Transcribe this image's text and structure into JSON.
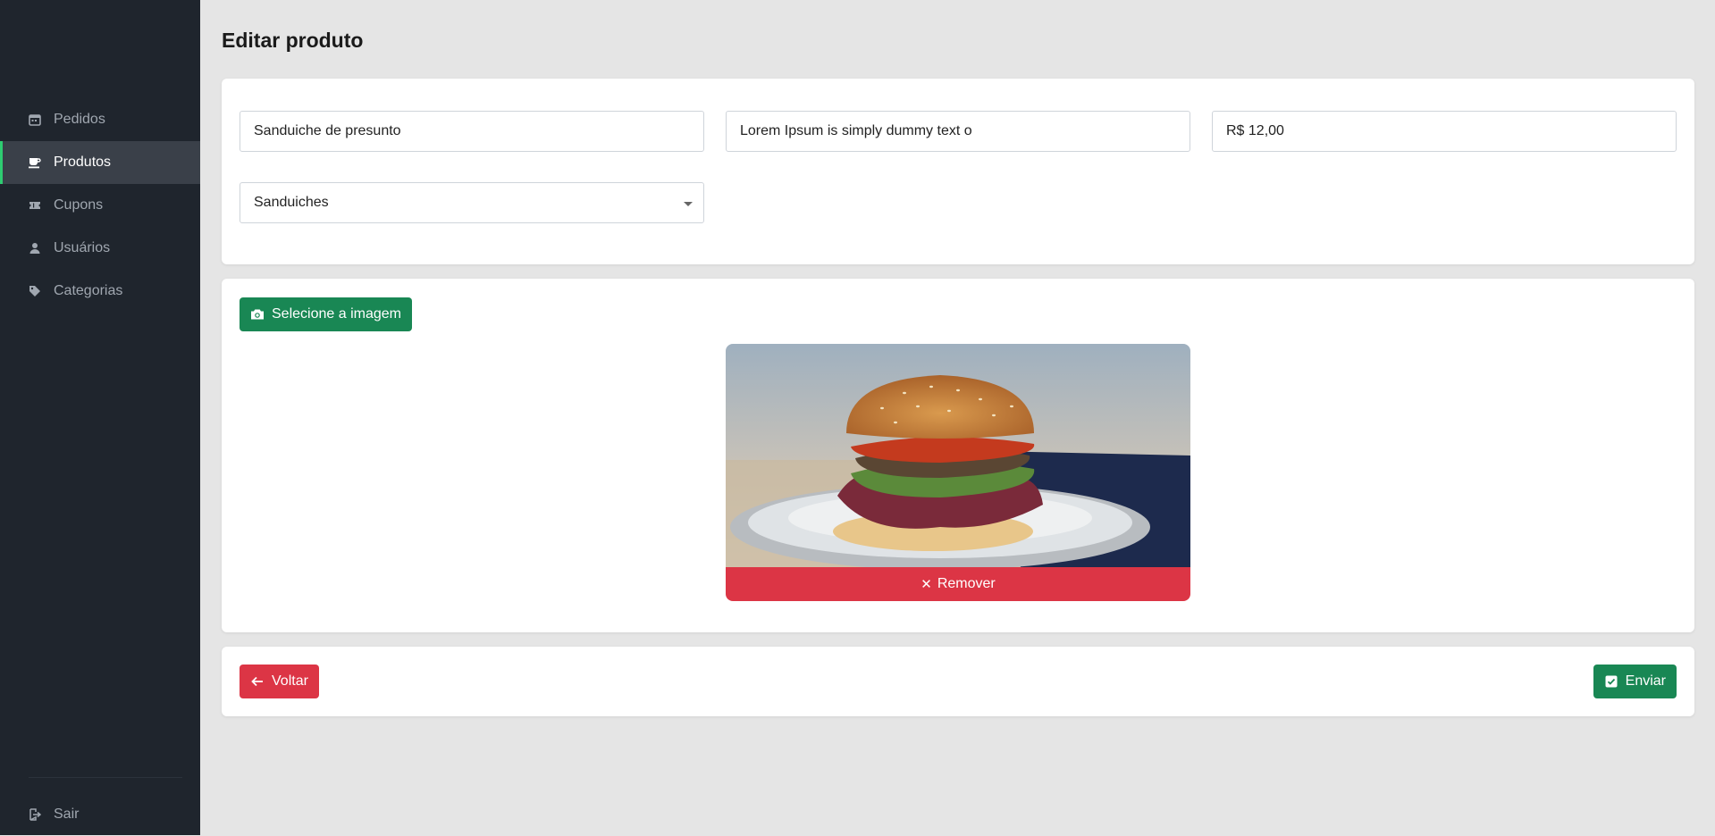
{
  "sidebar": {
    "items": [
      {
        "label": "Pedidos",
        "icon": "calendar-icon"
      },
      {
        "label": "Produtos",
        "icon": "coffee-icon",
        "active": true
      },
      {
        "label": "Cupons",
        "icon": "ticket-icon"
      },
      {
        "label": "Usuários",
        "icon": "user-icon"
      },
      {
        "label": "Categorias",
        "icon": "tag-icon"
      }
    ],
    "logout": {
      "label": "Sair",
      "icon": "logout-icon"
    }
  },
  "page": {
    "title": "Editar produto"
  },
  "form": {
    "name_value": "Sanduiche de presunto",
    "description_value": "Lorem Ipsum is simply dummy text o",
    "price_value": "R$ 12,00",
    "category_value": "Sanduiches"
  },
  "image_section": {
    "select_label": "Selecione a imagem",
    "remove_label": "Remover",
    "image_subject": "burger"
  },
  "actions": {
    "back_label": "Voltar",
    "send_label": "Enviar"
  },
  "colors": {
    "sidebar_bg": "#1f252d",
    "active_accent": "#2ecc71",
    "success": "#198754",
    "danger": "#dc3545",
    "page_bg": "#e5e5e5"
  }
}
